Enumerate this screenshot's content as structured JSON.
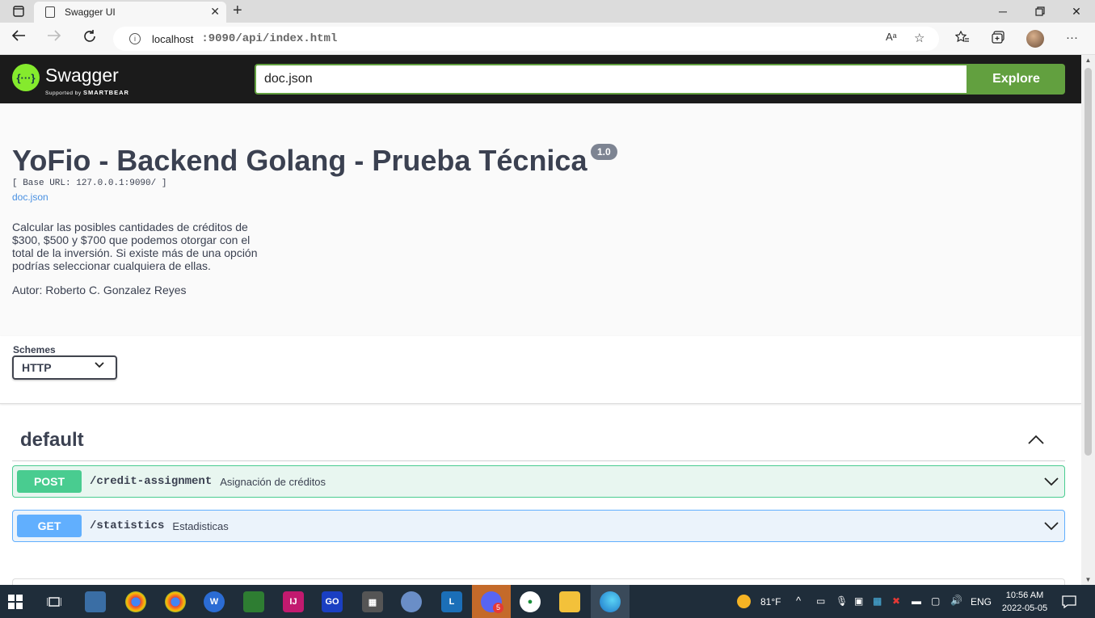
{
  "browser": {
    "tab_title": "Swagger UI",
    "url_host": "localhost",
    "url_path": ":9090/api/index.html",
    "read_aloud_label": "Aᵃ"
  },
  "swagger_header": {
    "logo_text": "Swagger",
    "logo_supported": "Supported by",
    "logo_brand": "SMARTBEAR",
    "url_value": "doc.json",
    "explore_label": "Explore"
  },
  "info": {
    "title": "YoFio - Backend Golang - Prueba Técnica",
    "version": "1.0",
    "base_url": "[ Base URL: 127.0.0.1:9090/ ]",
    "spec_link": "doc.json",
    "description": "Calcular las posibles cantidades de créditos de $300, $500 y $700 que podemos otorgar con el total de la inversión. Si existe más de una opción podrías seleccionar cualquiera de ellas.",
    "author": "Autor: Roberto C. Gonzalez Reyes"
  },
  "schemes": {
    "label": "Schemes",
    "selected": "HTTP"
  },
  "tag": {
    "name": "default"
  },
  "operations": [
    {
      "method": "POST",
      "path": "/credit-assignment",
      "summary": "Asignación de créditos"
    },
    {
      "method": "GET",
      "path": "/statistics",
      "summary": "Estadisticas"
    }
  ],
  "taskbar": {
    "temperature": "81°F",
    "language": "ENG",
    "time": "10:56 AM",
    "date": "2022-05-05",
    "badge_count": "5"
  },
  "colors": {
    "swagger_green": "#62a03f",
    "post_color": "#49cc90",
    "get_color": "#61affe",
    "topbar_bg": "#1b1b1b"
  }
}
